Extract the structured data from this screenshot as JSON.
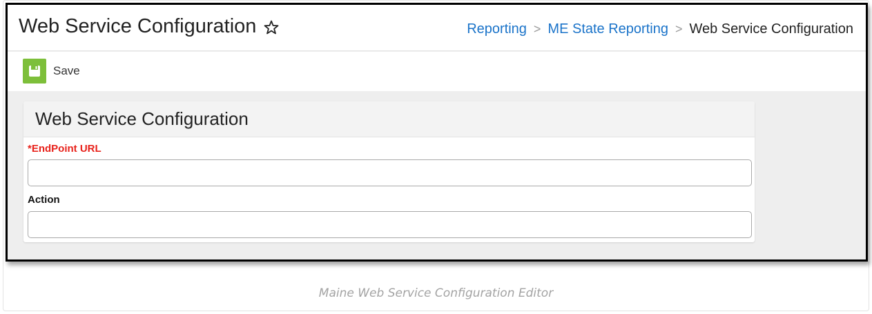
{
  "page": {
    "title": "Web Service Configuration"
  },
  "breadcrumb": {
    "items": [
      "Reporting",
      "ME State Reporting",
      "Web Service Configuration"
    ],
    "separator": ">"
  },
  "toolbar": {
    "save_label": "Save",
    "save_icon": "floppy-disk-icon",
    "save_color": "#7dbf3a"
  },
  "panel": {
    "title": "Web Service Configuration",
    "fields": [
      {
        "label": "*EndPoint URL",
        "required": true,
        "value": ""
      },
      {
        "label": "Action",
        "required": false,
        "value": ""
      }
    ]
  },
  "caption": "Maine Web Service Configuration Editor",
  "colors": {
    "link": "#1a73c9",
    "required": "#e8221b"
  }
}
